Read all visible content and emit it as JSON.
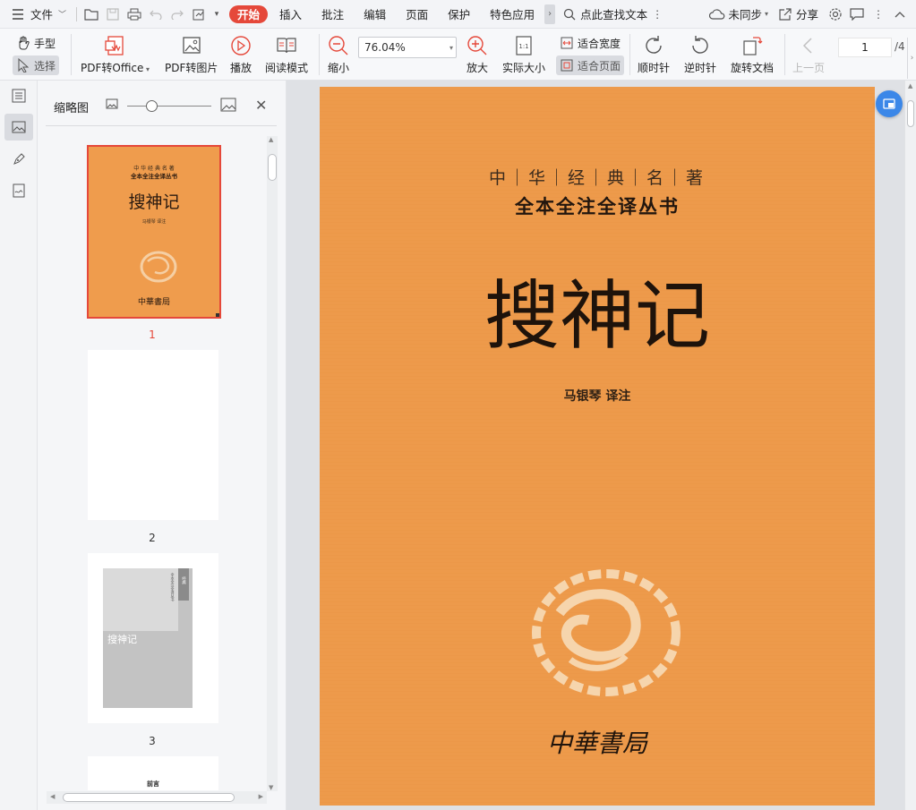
{
  "menubar": {
    "file_label": "文件",
    "tabs": [
      "开始",
      "插入",
      "批注",
      "编辑",
      "页面",
      "保护",
      "特色应用"
    ],
    "active_tab": "开始",
    "search_placeholder": "点此查找文本",
    "sync_label": "未同步",
    "share_label": "分享"
  },
  "toolbar": {
    "hand_label": "手型",
    "select_label": "选择",
    "pdf_office_label": "PDF转Office",
    "pdf_image_label": "PDF转图片",
    "play_label": "播放",
    "read_mode_label": "阅读模式",
    "zoom_out_label": "缩小",
    "zoom_value": "76.04%",
    "zoom_in_label": "放大",
    "actual_size_label": "实际大小",
    "fit_width_label": "适合宽度",
    "fit_page_label": "适合页面",
    "clockwise_label": "顺时针",
    "counter_clockwise_label": "逆时针",
    "rotate_doc_label": "旋转文档",
    "prev_page_label": "上一页",
    "current_page": "1",
    "total_pages": "/4"
  },
  "thumbnail_panel": {
    "title": "缩略图",
    "pages": [
      {
        "number": "1",
        "selected": true
      },
      {
        "number": "2",
        "selected": false
      },
      {
        "number": "3",
        "selected": false
      }
    ],
    "thumb1": {
      "series_top": "中 华 经 典 名 著",
      "series_bottom": "全本全注全译丛书",
      "title": "搜神记",
      "author": "马银琴 译注",
      "publisher": "中華書局"
    },
    "thumb3": {
      "title": "搜神记",
      "side_text": "全本全注全译丛书",
      "side_label": "经典"
    },
    "thumb4": {
      "heading": "前言"
    }
  },
  "document": {
    "series_top": "中｜华｜经｜典｜名｜著",
    "series_bottom": "全本全注全译丛书",
    "title": "搜神记",
    "author": "马银琴 译注",
    "publisher": "中華書局"
  },
  "colors": {
    "accent": "#e5483a",
    "cover_orange": "#ee9a4a",
    "float_button": "#3b87e8"
  }
}
